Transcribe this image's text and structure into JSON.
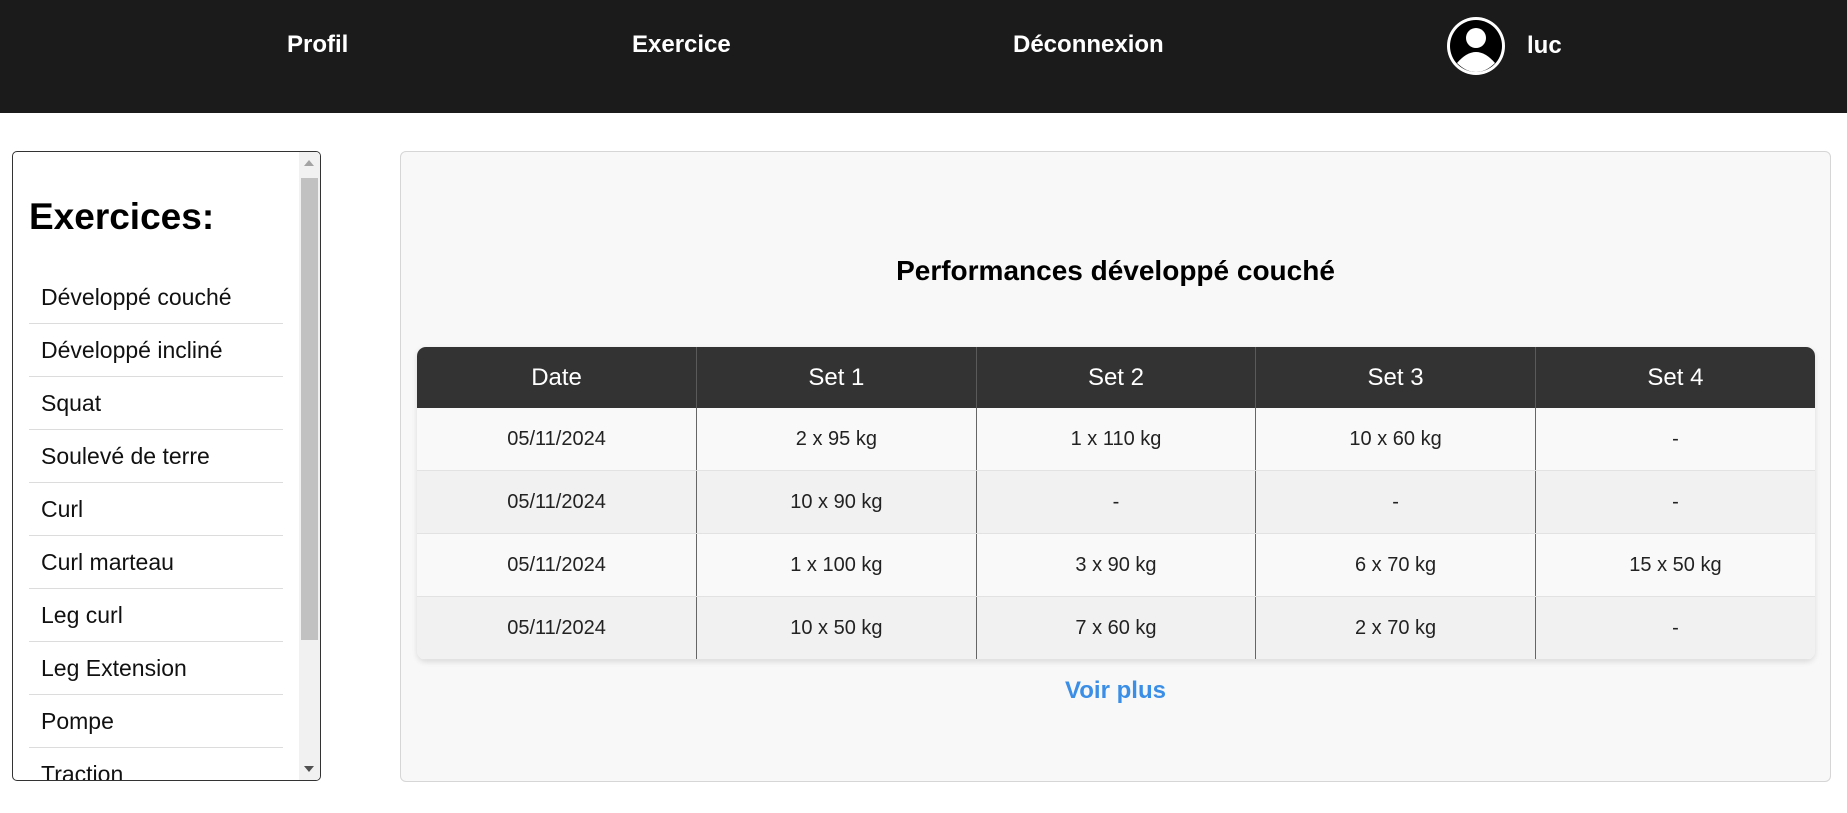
{
  "nav": {
    "profil": "Profil",
    "exercice": "Exercice",
    "deconnexion": "Déconnexion",
    "username": "luc",
    "avatar_icon": "user-circle-icon"
  },
  "sidebar": {
    "title": "Exercices:",
    "items": [
      "Développé couché",
      "Développé incliné",
      "Squat",
      "Soulevé de terre",
      "Curl",
      "Curl marteau",
      "Leg curl",
      "Leg Extension",
      "Pompe",
      "Traction"
    ]
  },
  "main": {
    "title": "Performances développé couché",
    "table": {
      "headers": [
        "Date",
        "Set 1",
        "Set 2",
        "Set 3",
        "Set 4"
      ],
      "rows": [
        [
          "05/11/2024",
          "2 x 95 kg",
          "1 x 110 kg",
          "10 x 60 kg",
          "-"
        ],
        [
          "05/11/2024",
          "10 x 90 kg",
          "-",
          "-",
          "-"
        ],
        [
          "05/11/2024",
          "1 x 100 kg",
          "3 x 90 kg",
          "6 x 70 kg",
          "15 x 50 kg"
        ],
        [
          "05/11/2024",
          "10 x 50 kg",
          "7 x 60 kg",
          "2 x 70 kg",
          "-"
        ]
      ]
    },
    "voir_plus": "Voir plus"
  },
  "colors": {
    "navbar": "#1b1b1b",
    "table_header": "#333333",
    "link": "#3a8ee6"
  }
}
